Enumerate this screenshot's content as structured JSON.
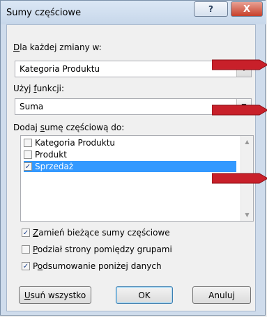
{
  "dialog": {
    "title": "Sumy częściowe",
    "help_label": "?",
    "close_label": "X"
  },
  "group_by": {
    "label_prefix": "D",
    "label_rest": "la każdej zmiany w:",
    "value": "Kategoria Produktu"
  },
  "function": {
    "label_prefix": "Użyj ",
    "label_ul": "f",
    "label_rest": "unkcji:",
    "value": "Suma"
  },
  "add_subtotal": {
    "label_prefix": "Dodaj ",
    "label_ul": "s",
    "label_rest": "umę częściową do:",
    "items": [
      {
        "label": "Kategoria Produktu",
        "checked": false
      },
      {
        "label": "Produkt",
        "checked": false
      },
      {
        "label": "Sprzedaż",
        "checked": true
      }
    ]
  },
  "options": {
    "replace": {
      "ul": "Z",
      "rest": "amień bieżące sumy częściowe",
      "checked": true
    },
    "page_break": {
      "ul": "P",
      "rest": "odział strony pomiędzy grupami",
      "checked": false
    },
    "summary_below": {
      "pre": "P",
      "ul": "o",
      "rest": "dsumowanie poniżej danych",
      "checked": true
    }
  },
  "buttons": {
    "remove_all_ul": "U",
    "remove_all_rest": "suń wszystko",
    "ok": "OK",
    "cancel": "Anuluj"
  },
  "colors": {
    "accent_red": "#c8202a",
    "selection": "#3399ff"
  },
  "icons": {
    "check": "✓",
    "scroll_up": "▲",
    "scroll_down": "▼",
    "dropdown": "▼"
  }
}
